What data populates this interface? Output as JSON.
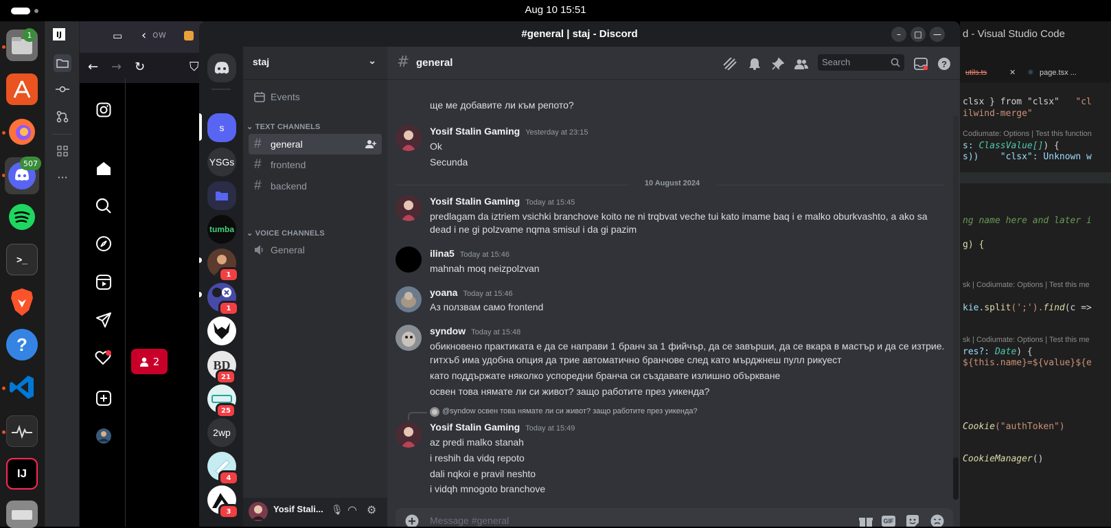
{
  "topbar": {
    "clock": "Aug 10  15:51"
  },
  "dock": {
    "items": [
      {
        "name": "files",
        "badge": "1"
      },
      {
        "name": "app-center"
      },
      {
        "name": "firefox"
      },
      {
        "name": "discord",
        "badge": "507"
      },
      {
        "name": "spotify"
      },
      {
        "name": "terminal",
        "label": ">_"
      },
      {
        "name": "brave"
      },
      {
        "name": "help",
        "label": "?"
      },
      {
        "name": "vscode"
      },
      {
        "name": "system-monitor"
      },
      {
        "name": "intellij",
        "label": "IJ"
      }
    ]
  },
  "browser": {
    "tab_label": "ow",
    "notification_count": "2"
  },
  "vscode": {
    "title": "d - Visual Studio Code",
    "tabs": [
      "utils.ts",
      "page.tsx ..."
    ],
    "lines": {
      "l1a": "clsx } from \"clsx\"",
      "l1b": "\"cl",
      "l2": "ilwind-merge\"",
      "h1": "Codiumate: Options | Test this function",
      "l3a": "s: ",
      "l3b": "ClassValue[]",
      "l3c": ") {",
      "l4a": "s))",
      "l4b": "\"clsx\": Unknown w",
      "l5": "ng name here and later i",
      "l6": "g) {",
      "h2": "sk | Codiumate: Options | Test this me",
      "l7a": "kie.",
      "l7b": "split",
      "l7c": "(';').",
      "l7d": "find",
      "l7e": "(c =>",
      "h3": "sk | Codiumate: Options | Test this me",
      "l8a": "res?: ",
      "l8b": "Date",
      "l8c": ") {",
      "l9a": "${this.name}=${value}${e",
      "l10a": "Cookie",
      "l10b": "(\"authToken\")",
      "l11a": "CookieManager",
      "l11b": "()"
    }
  },
  "discord": {
    "window_title": "#general | staj - Discord",
    "guilds": [
      {
        "label": "s",
        "type": "text"
      },
      {
        "label": "YSGs",
        "type": "text"
      },
      {
        "label": "",
        "type": "folder"
      },
      {
        "label": "tumba",
        "type": "text"
      },
      {
        "label": "",
        "type": "image",
        "badge": "1"
      },
      {
        "label": "",
        "type": "image",
        "badge": "1"
      },
      {
        "label": "",
        "type": "image"
      },
      {
        "label": "BD",
        "type": "image",
        "badge": "21"
      },
      {
        "label": "",
        "type": "image",
        "badge": "25"
      },
      {
        "label": "2wp",
        "type": "text"
      },
      {
        "label": "",
        "type": "image",
        "badge": "4"
      },
      {
        "label": "",
        "type": "image",
        "badge": "3"
      }
    ],
    "server_name": "staj",
    "events_label": "Events",
    "text_category": "TEXT CHANNELS",
    "voice_category": "VOICE CHANNELS",
    "text_channels": [
      "general",
      "frontend",
      "backend"
    ],
    "voice_channels": [
      "General"
    ],
    "user_name": "Yosif Stali...",
    "channel_name": "general",
    "search_placeholder": "Search",
    "message_placeholder": "Message #general",
    "date_divider": "10 August 2024",
    "messages": [
      {
        "text": "ще ме добавите ли към репото?"
      },
      {
        "author": "Yosif Stalin Gaming",
        "time": "Yesterday at 23:15",
        "lines": [
          "Ok",
          "Secunda"
        ]
      },
      {
        "author": "Yosif Stalin Gaming",
        "time": "Today at 15:45",
        "lines": [
          "predlagam da iztriem vsichki branchove koito ne ni trqbvat veche tui kato imame baq i e malko oburkvashto, a ako sa",
          "dead i ne gi polzvame nqma smisul i da gi pazim"
        ]
      },
      {
        "author": "ilina5",
        "time": "Today at 15:46",
        "lines": [
          "mahnah moq neizpolzvan"
        ]
      },
      {
        "author": "yoana",
        "time": "Today at 15:46",
        "lines": [
          "Аз ползвам само frontend"
        ]
      },
      {
        "author": "syndow",
        "time": "Today at 15:48",
        "lines": [
          "обикновено практиката е да се направи 1 бранч за 1 фийчър, да се завърши, да се вкара в мастър и да се изтрие.",
          "гитхъб има удобна опция да трие автоматично бранчове след като мърджнеш пулл рикуест",
          "като поддържате няколко успоредни бранча си създавате излишно объркване",
          "освен това нямате ли си живот? защо работите през уикенда?"
        ]
      },
      {
        "reply": "@syndow освен това нямате ли си живот? защо работите през уикенда?",
        "author": "Yosif Stalin Gaming",
        "time": "Today at 15:49",
        "lines": [
          "az predi malko stanah",
          "i reshih da vidq repoto",
          "dali nqkoi e pravil neshto",
          "i vidqh mnogoto branchove"
        ]
      }
    ]
  }
}
